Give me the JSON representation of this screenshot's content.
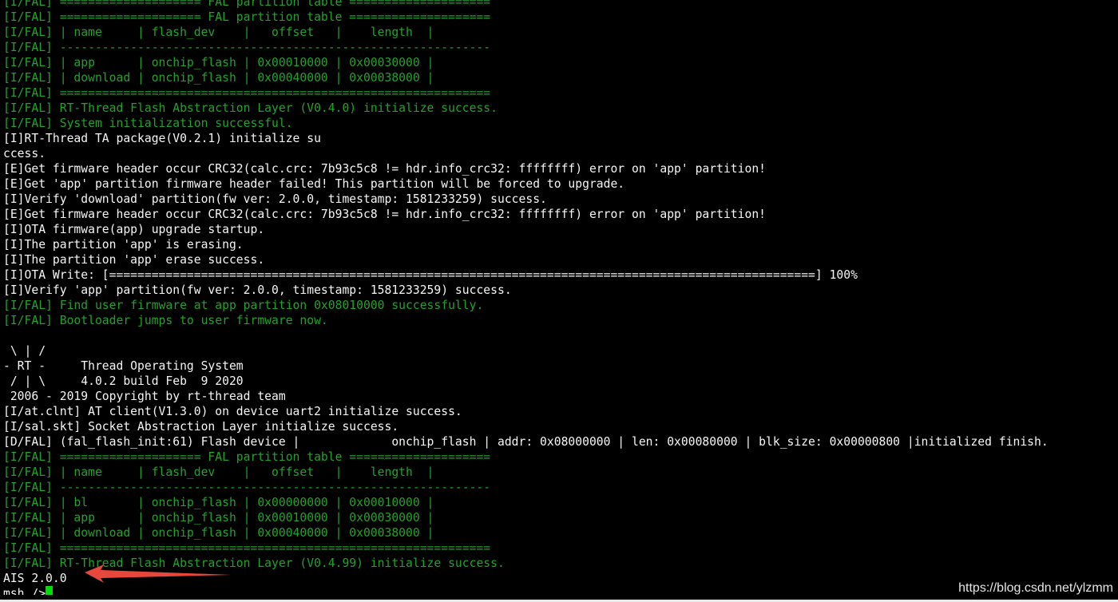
{
  "terminal": {
    "lines": [
      {
        "text": "[I/FAL] ==================== FAL partition table ===================="
      },
      {
        "text": "[I/FAL] ==================== FAL partition table ===================="
      },
      {
        "text": "[I/FAL] | name     | flash_dev    |   offset   |    length  |"
      },
      {
        "text": "[I/FAL] -------------------------------------------------------------"
      },
      {
        "text": "[I/FAL] | app      | onchip_flash | 0x00010000 | 0x00030000 |"
      },
      {
        "text": "[I/FAL] | download | onchip_flash | 0x00040000 | 0x00038000 |"
      },
      {
        "text": "[I/FAL] ============================================================="
      },
      {
        "text": "[I/FAL] RT-Thread Flash Abstraction Layer (V0.4.0) initialize success."
      },
      {
        "text": "[I/FAL] System initialization successful."
      },
      {
        "text": "[I]RT-Thread TA package(V0.2.1) initialize su"
      },
      {
        "text": "ccess."
      },
      {
        "text": "[E]Get firmware header occur CRC32(calc.crc: 7b93c5c8 != hdr.info_crc32: ffffffff) error on 'app' partition!"
      },
      {
        "text": "[E]Get 'app' partition firmware header failed! This partition will be forced to upgrade."
      },
      {
        "text": "[I]Verify 'download' partition(fw ver: 2.0.0, timestamp: 1581233259) success."
      },
      {
        "text": "[E]Get firmware header occur CRC32(calc.crc: 7b93c5c8 != hdr.info_crc32: ffffffff) error on 'app' partition!"
      },
      {
        "text": "[I]OTA firmware(app) upgrade startup."
      },
      {
        "text": "[I]The partition 'app' is erasing."
      },
      {
        "text": "[I]The partition 'app' erase success."
      },
      {
        "text": "[I]OTA Write: [====================================================================================================] 100%"
      },
      {
        "text": "[I]Verify 'app' partition(fw ver: 2.0.0, timestamp: 1581233259) success."
      },
      {
        "text": "[I/FAL] Find user firmware at app partition 0x08010000 successfully."
      },
      {
        "text": "[I/FAL] Bootloader jumps to user firmware now."
      },
      {
        "text": ""
      },
      {
        "text": " \\ | /"
      },
      {
        "text": "- RT -     Thread Operating System"
      },
      {
        "text": " / | \\     4.0.2 build Feb  9 2020"
      },
      {
        "text": " 2006 - 2019 Copyright by rt-thread team"
      },
      {
        "text": "[I/at.clnt] AT client(V1.3.0) on device uart2 initialize success."
      },
      {
        "text": "[I/sal.skt] Socket Abstraction Layer initialize success."
      },
      {
        "text": "[D/FAL] (fal_flash_init:61) Flash device |             onchip_flash | addr: 0x08000000 | len: 0x00080000 | blk_size: 0x00000800 |initialized finish."
      },
      {
        "text": "[I/FAL] ==================== FAL partition table ===================="
      },
      {
        "text": "[I/FAL] | name     | flash_dev    |   offset   |    length  |"
      },
      {
        "text": "[I/FAL] -------------------------------------------------------------"
      },
      {
        "text": "[I/FAL] | bl       | onchip_flash | 0x00000000 | 0x00010000 |"
      },
      {
        "text": "[I/FAL] | app      | onchip_flash | 0x00010000 | 0x00030000 |"
      },
      {
        "text": "[I/FAL] | download | onchip_flash | 0x00040000 | 0x00038000 |"
      },
      {
        "text": "[I/FAL] ============================================================="
      },
      {
        "text": "[I/FAL] RT-Thread Flash Abstraction Layer (V0.4.99) initialize success."
      },
      {
        "text": "AIS 2.0.0"
      },
      {
        "text": "msh />"
      }
    ]
  },
  "watermark": "https://blog.csdn.net/ylzmm",
  "colors": {
    "background": "#000000",
    "log_green": "#22a22a",
    "log_white": "#f5f5f5",
    "cursor": "#00e000",
    "arrow": "#e8483c"
  }
}
